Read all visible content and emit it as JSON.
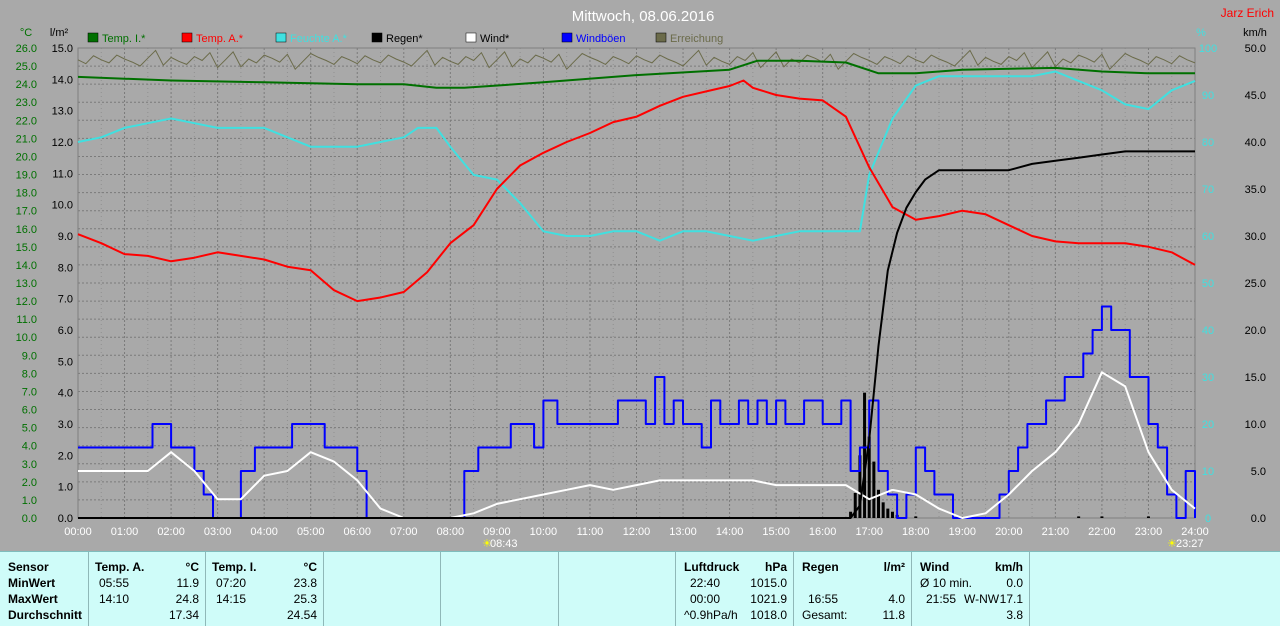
{
  "title": "Mittwoch, 08.06.2016",
  "author": "Jarz Erich",
  "left_units": {
    "temp": "°C",
    "rain": "l/m²"
  },
  "right_units": {
    "pct": "%",
    "wind": "km/h"
  },
  "legend": [
    {
      "label": "Temp. I.*",
      "color": "#007000"
    },
    {
      "label": "Temp. A.*",
      "color": "#ff0000"
    },
    {
      "label": "Feuchte A.*",
      "color": "#40e0e0"
    },
    {
      "label": "Regen*",
      "color": "#000000"
    },
    {
      "label": "Wind*",
      "color": "#ffffff"
    },
    {
      "label": "Windböen",
      "color": "#0000ff"
    },
    {
      "label": "Erreichung",
      "color": "#6b6b4a"
    }
  ],
  "sunrise_label": "08:43",
  "sunset_label": "23:27",
  "axis_ticks": {
    "temp": [
      "26.0",
      "25.0",
      "24.0",
      "23.0",
      "22.0",
      "21.0",
      "20.0",
      "19.0",
      "18.0",
      "17.0",
      "16.0",
      "15.0",
      "14.0",
      "13.0",
      "12.0",
      "11.0",
      "10.0",
      "9.0",
      "8.0",
      "7.0",
      "6.0",
      "5.0",
      "4.0",
      "3.0",
      "2.0",
      "1.0",
      "0.0"
    ],
    "rain": [
      "15.0",
      "14.0",
      "13.0",
      "12.0",
      "11.0",
      "10.0",
      "9.0",
      "8.0",
      "7.0",
      "6.0",
      "5.0",
      "4.0",
      "3.0",
      "2.0",
      "1.0",
      "0.0"
    ],
    "pct": [
      "100",
      "90",
      "80",
      "70",
      "60",
      "50",
      "40",
      "30",
      "20",
      "10",
      "0"
    ],
    "wind": [
      "50.0",
      "45.0",
      "40.0",
      "35.0",
      "30.0",
      "25.0",
      "20.0",
      "15.0",
      "10.0",
      "5.0",
      "0.0"
    ],
    "x": [
      "00:00",
      "01:00",
      "02:00",
      "03:00",
      "04:00",
      "05:00",
      "06:00",
      "07:00",
      "08:00",
      "09:00",
      "10:00",
      "11:00",
      "12:00",
      "13:00",
      "14:00",
      "15:00",
      "16:00",
      "17:00",
      "18:00",
      "19:00",
      "20:00",
      "21:00",
      "22:00",
      "23:00",
      "24:00"
    ]
  },
  "chart_data": {
    "type": "line",
    "title": "Mittwoch, 08.06.2016",
    "x_unit": "hours",
    "xlim": [
      0,
      24
    ],
    "axes": {
      "temp": [
        0,
        26
      ],
      "rain": [
        0,
        15
      ],
      "humidity": [
        0,
        100
      ],
      "wind": [
        0,
        50
      ]
    },
    "grid": true,
    "series": [
      {
        "name": "Temp. I.*",
        "axis": "temp",
        "color": "#007000",
        "x": [
          0,
          2,
          4,
          6,
          7,
          7.7,
          8.3,
          10,
          12,
          14,
          14.6,
          15.5,
          16.5,
          17.2,
          18,
          19,
          21,
          22,
          23,
          24
        ],
        "y": [
          24.4,
          24.2,
          24.1,
          24.0,
          24.0,
          23.8,
          23.8,
          24.1,
          24.5,
          24.8,
          25.3,
          25.3,
          25.2,
          24.6,
          24.6,
          24.8,
          24.9,
          24.7,
          24.6,
          24.6
        ]
      },
      {
        "name": "Temp. A.*",
        "axis": "temp",
        "color": "#ff0000",
        "x": [
          0,
          0.5,
          1,
          1.5,
          2,
          2.5,
          3,
          3.5,
          4,
          4.5,
          5,
          5.5,
          6,
          6.5,
          7,
          7.5,
          8,
          8.5,
          9,
          9.5,
          10,
          10.5,
          11,
          11.5,
          12,
          12.5,
          13,
          13.5,
          14,
          14.3,
          14.5,
          15,
          15.5,
          16,
          16.5,
          17,
          17.5,
          18,
          18.5,
          19,
          19.5,
          20,
          20.5,
          21,
          21.5,
          22,
          22.5,
          23,
          23.5,
          24
        ],
        "y": [
          15.7,
          15.2,
          14.6,
          14.5,
          14.2,
          14.4,
          14.7,
          14.5,
          14.3,
          13.9,
          13.7,
          12.6,
          12.0,
          12.2,
          12.5,
          13.6,
          15.2,
          16.2,
          18.2,
          19.5,
          20.2,
          20.8,
          21.3,
          21.9,
          22.2,
          22.8,
          23.3,
          23.6,
          23.9,
          24.2,
          23.8,
          23.4,
          23.2,
          23.1,
          22.2,
          19.4,
          17.2,
          16.5,
          16.7,
          17.0,
          16.8,
          16.2,
          15.6,
          15.3,
          15.2,
          15.2,
          15.2,
          15.0,
          14.7,
          14.0
        ]
      },
      {
        "name": "Feuchte A.*",
        "axis": "humidity",
        "color": "#40e0e0",
        "x": [
          0,
          0.5,
          1,
          1.5,
          2,
          2.5,
          3,
          3.5,
          4,
          4.5,
          5,
          5.5,
          6,
          6.5,
          7,
          7.3,
          7.7,
          8,
          8.5,
          9,
          9.5,
          10,
          10.5,
          11,
          11.5,
          12,
          12.5,
          13,
          13.5,
          14,
          14.5,
          15,
          15.5,
          16,
          16.5,
          16.8,
          17,
          17.5,
          18,
          18.5,
          19,
          19.5,
          20,
          20.5,
          21,
          21.5,
          22,
          22.5,
          23,
          23.5,
          24
        ],
        "y": [
          80,
          81,
          83,
          84,
          85,
          84,
          83,
          83,
          83,
          81,
          79,
          79,
          79,
          80,
          81,
          83,
          83,
          79,
          73,
          72,
          67,
          61,
          60,
          60,
          61,
          61,
          59,
          61,
          61,
          60,
          59,
          60,
          61,
          61,
          61,
          61,
          73,
          85,
          92,
          94,
          94,
          94,
          94,
          94,
          95,
          93,
          91,
          88,
          87,
          91,
          93
        ]
      },
      {
        "name": "Regen*",
        "axis": "rain",
        "color": "#000000",
        "x": [
          0,
          16.6,
          16.8,
          17.0,
          17.2,
          17.4,
          17.6,
          17.8,
          18.0,
          18.2,
          18.5,
          19,
          19.5,
          20,
          20.5,
          21,
          21.5,
          22,
          22.5,
          23,
          24
        ],
        "y": [
          0,
          0,
          0.4,
          2.5,
          5.5,
          7.9,
          9.1,
          9.9,
          10.4,
          10.8,
          11.1,
          11.1,
          11.1,
          11.1,
          11.3,
          11.4,
          11.5,
          11.6,
          11.7,
          11.7,
          11.7
        ]
      },
      {
        "name": "Wind*",
        "axis": "wind",
        "color": "#ffffff",
        "x": [
          0,
          0.5,
          1,
          1.5,
          2,
          2.5,
          3,
          3.5,
          4,
          4.5,
          5,
          5.5,
          6,
          6.5,
          7,
          7.5,
          8,
          8.5,
          9,
          9.5,
          10,
          10.5,
          11,
          11.5,
          12,
          12.5,
          13,
          13.5,
          14,
          14.5,
          15,
          15.5,
          16,
          16.5,
          17,
          17.5,
          18,
          18.5,
          19,
          19.5,
          20,
          20.5,
          21,
          21.5,
          22,
          22.5,
          23,
          23.5,
          24
        ],
        "y": [
          5,
          5,
          5,
          5,
          7,
          5,
          2,
          2,
          4.5,
          5,
          7,
          6,
          4,
          1,
          0,
          0,
          0,
          0.5,
          1.5,
          2,
          2.5,
          3,
          3.5,
          3,
          3.5,
          4,
          4,
          4,
          4,
          4,
          3.5,
          3.5,
          3.5,
          3.5,
          2,
          3,
          2.5,
          1,
          0,
          0.5,
          2.5,
          5,
          7,
          10,
          15.5,
          14,
          7,
          3,
          1
        ]
      },
      {
        "name": "Windböen",
        "axis": "wind",
        "color": "#0000ff",
        "x": [
          0,
          0.3,
          0.6,
          1,
          1.3,
          1.6,
          1.8,
          2,
          2.3,
          2.5,
          2.7,
          2.9,
          3.1,
          3.5,
          3.8,
          4,
          4.3,
          4.6,
          5,
          5.3,
          5.6,
          6,
          6.2,
          6.5,
          7,
          7.2,
          7.6,
          8,
          8.3,
          8.6,
          9,
          9.3,
          9.5,
          9.8,
          10,
          10.3,
          10.6,
          11,
          11.3,
          11.6,
          12,
          12.2,
          12.4,
          12.6,
          12.8,
          13,
          13.2,
          13.4,
          13.6,
          13.8,
          14,
          14.2,
          14.4,
          14.6,
          14.8,
          15,
          15.2,
          15.4,
          15.6,
          15.8,
          16,
          16.2,
          16.4,
          16.6,
          16.8,
          17,
          17.2,
          17.4,
          17.6,
          17.8,
          18,
          18.2,
          18.4,
          18.6,
          18.8,
          19,
          19.2,
          19.4,
          19.6,
          19.8,
          20,
          20.2,
          20.4,
          20.6,
          20.8,
          21,
          21.2,
          21.4,
          21.6,
          21.8,
          22,
          22.2,
          22.4,
          22.6,
          22.8,
          23,
          23.2,
          23.4,
          23.6,
          23.8,
          24
        ],
        "y": [
          7.5,
          7.5,
          7.5,
          7.5,
          7.5,
          10,
          10,
          7.5,
          7.5,
          5,
          2.5,
          0,
          0,
          5,
          7.5,
          7.5,
          7.5,
          10,
          10,
          7.5,
          7.5,
          5,
          0,
          0,
          0,
          0,
          0,
          0,
          5,
          7.5,
          7.5,
          10,
          10,
          7.5,
          12.5,
          10,
          10,
          10,
          10,
          12.5,
          12.5,
          10,
          15,
          10,
          12.5,
          10,
          10,
          7.5,
          12.5,
          10,
          10,
          12.5,
          10,
          12.5,
          10,
          12.5,
          10,
          10,
          12.5,
          12.5,
          10,
          10,
          12.5,
          5,
          7.5,
          12.5,
          5,
          2.5,
          0,
          2.5,
          7.5,
          5,
          2.5,
          2.5,
          0,
          0,
          0,
          0,
          0,
          2.5,
          5,
          7.5,
          10,
          10,
          12.5,
          12.5,
          15,
          15,
          17.5,
          20,
          22.5,
          20,
          20,
          15,
          15,
          10,
          7.5,
          2.5,
          0,
          5,
          0
        ]
      }
    ],
    "rain_bars": {
      "x": [
        16.6,
        16.7,
        16.8,
        16.9,
        17.0,
        17.1,
        17.2,
        17.3,
        17.4,
        17.5,
        17.6,
        18.0,
        21.5,
        22.0,
        23.0
      ],
      "y": [
        0.2,
        0.8,
        2.0,
        4.0,
        2.6,
        1.8,
        0.9,
        0.5,
        0.3,
        0.2,
        0.1,
        0.05,
        0.05,
        0.05,
        0.05
      ]
    }
  },
  "stats": {
    "sensor_header": "Sensor",
    "row_labels": [
      "MinWert",
      "MaxWert",
      "Durchschnitt"
    ],
    "temp_a": {
      "header": "Temp. A.",
      "unit": "°C",
      "rows": [
        {
          "time": "05:55",
          "value": "11.9"
        },
        {
          "time": "14:10",
          "value": "24.8"
        },
        {
          "time": "",
          "value": "17.34"
        }
      ]
    },
    "temp_i": {
      "header": "Temp. I.",
      "unit": "°C",
      "rows": [
        {
          "time": "07:20",
          "value": "23.8"
        },
        {
          "time": "14:15",
          "value": "25.3"
        },
        {
          "time": "",
          "value": "24.54"
        }
      ]
    },
    "pressure": {
      "header": "Luftdruck",
      "unit": "hPa",
      "rows": [
        {
          "time": "22:40",
          "value": "1015.0"
        },
        {
          "time": "00:00",
          "value": "1021.9"
        },
        {
          "time": "^0.9hPa/h",
          "value": "1018.0"
        }
      ]
    },
    "rain": {
      "header": "Regen",
      "unit": "l/m²",
      "rows": [
        {
          "time": "",
          "value": ""
        },
        {
          "time": "16:55",
          "value": "4.0"
        },
        {
          "time": "Gesamt:",
          "value": "11.8"
        }
      ]
    },
    "wind": {
      "header": "Wind",
      "unit": "km/h",
      "rows": [
        {
          "time": "Ø 10 min.",
          "value": "0.0"
        },
        {
          "time": "21:55",
          "dir": "W-NW",
          "value": "17.1"
        },
        {
          "time": "",
          "value": "3.8"
        }
      ]
    }
  }
}
